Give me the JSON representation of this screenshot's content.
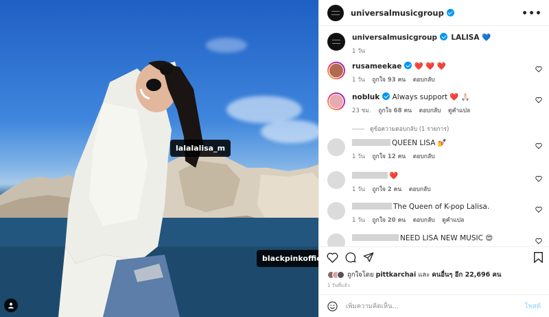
{
  "photo": {
    "tags": [
      "lalalalisa_m",
      "blackpinkofficial"
    ],
    "icons": [
      "person-tag-icon"
    ]
  },
  "header": {
    "username": "universalmusicgroup",
    "more_icon": "more-horizontal-icon"
  },
  "caption": {
    "username": "universalmusicgroup",
    "text": "LALISA 💙",
    "time": "1 วัน"
  },
  "comments": [
    {
      "username": "rusameekae",
      "verified": true,
      "text": "❤️ ❤️ ❤️",
      "time": "1 วัน",
      "likes": "ถูกใจ 93 คน",
      "reply": "ตอบกลับ",
      "translate": ""
    },
    {
      "username": "nobluk",
      "verified": true,
      "text": "Always support ❤️ 🙏🏻",
      "time": "23 ชม.",
      "likes": "ถูกใจ 68 คน",
      "reply": "ตอบกลับ",
      "translate": "ดูคำแปล"
    },
    {
      "username": "",
      "text": "QUEEN LISA 💅",
      "time": "1 วัน",
      "likes": "ถูกใจ 12 คน",
      "reply": "ตอบกลับ",
      "translate": ""
    },
    {
      "username": "",
      "text": "❤️",
      "time": "1 วัน",
      "likes": "ถูกใจ 2 คน",
      "reply": "ตอบกลับ",
      "translate": ""
    },
    {
      "username": "",
      "text": "The Queen of K-pop Lalisa.",
      "time": "1 วัน",
      "likes": "ถูกใจ 20 คน",
      "reply": "ตอบกลับ",
      "translate": "ดูคำแปล"
    },
    {
      "username": "",
      "text": "NEED LISA NEW MUSIC 😍",
      "time": "",
      "likes": "",
      "reply": "",
      "translate": ""
    }
  ],
  "view_replies": "ดูข้อความตอบกลับ (1 รายการ)",
  "actions": {
    "icons": [
      "heart-icon",
      "comment-icon",
      "share-icon",
      "bookmark-icon"
    ]
  },
  "likes": {
    "prefix": "ถูกใจโดย",
    "user": "pittkarchai",
    "middle": "และ",
    "others": "คนอื่นๆ อีก 22,696 คน"
  },
  "post_time": "1 วันที่แล้ว",
  "add_comment": {
    "placeholder": "เพิ่มความคิดเห็น...",
    "post_label": "โพสต์",
    "emoji_icon": "emoji-icon"
  },
  "colors": {
    "verified": "#0095f6",
    "link_disabled": "#b2dffc",
    "heart_red": "#ed4956"
  }
}
